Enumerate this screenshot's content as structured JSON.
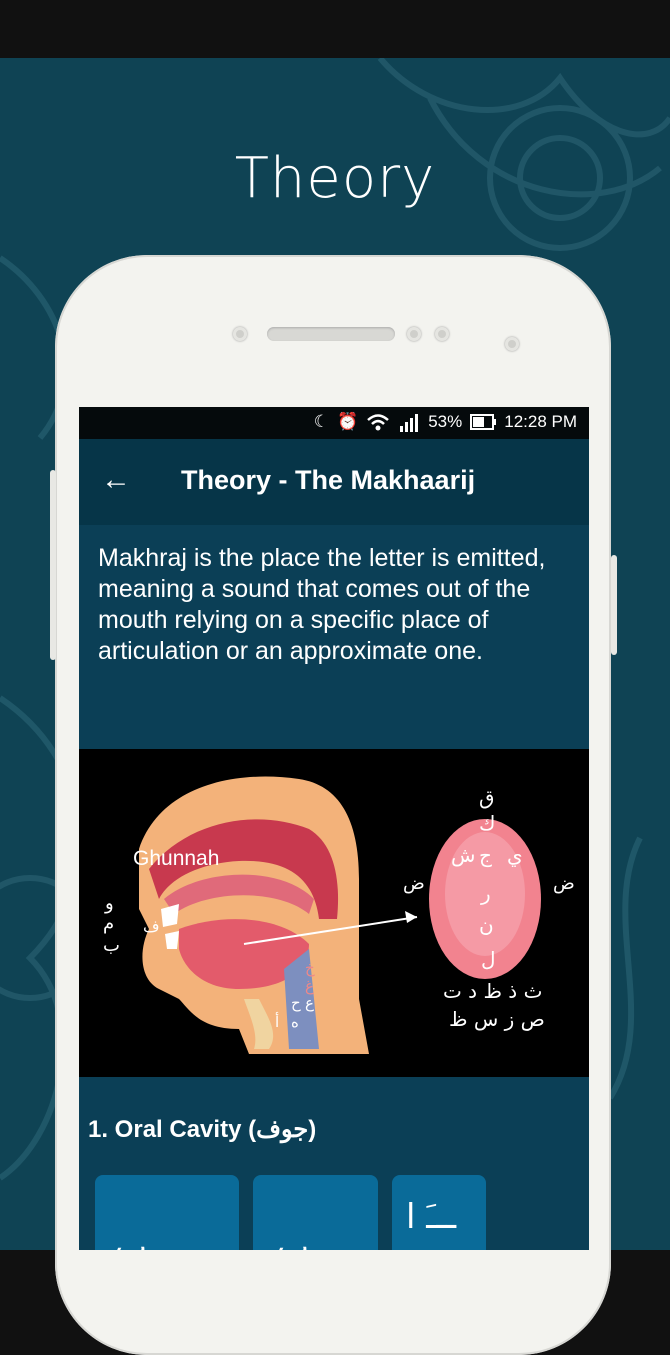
{
  "promo": {
    "title": "Theory"
  },
  "status": {
    "battery": "53%",
    "time": "12:28 PM"
  },
  "appbar": {
    "back": "←",
    "title": "Theory - The Makhaarij"
  },
  "intro": "Makhraj is the place the letter is emitted, meaning a sound that comes out of the mouth relying on a specific place of articulation or an approximate one.",
  "figure": {
    "ghunnah": "Ghunnah",
    "lips": [
      "و",
      "م",
      "ب",
      "ف"
    ],
    "throat": [
      "خ",
      "غ",
      "ح",
      "ع",
      "ه",
      "أ"
    ],
    "tongue_top": [
      "ق",
      "ك"
    ],
    "tongue_mid": [
      "ش",
      "ج",
      "ي"
    ],
    "tongue_lower": [
      "ر",
      "ن",
      "ل"
    ],
    "tongue_side": "ض",
    "bottom_row1": "ث ذ ظ د ت",
    "bottom_row2": "ص ز س ظ"
  },
  "section": {
    "title": "1. Oral Cavity (جوف)"
  },
  "cards": [
    {
      "text": "ـــ ٮ"
    },
    {
      "text": "ـــ ٮ"
    },
    {
      "text": "ـــَ ا"
    }
  ],
  "colors": {
    "teal_bg": "#0f4354",
    "screen_bg": "#0b3f56",
    "appbar": "#063548",
    "card": "#0a6b99"
  }
}
